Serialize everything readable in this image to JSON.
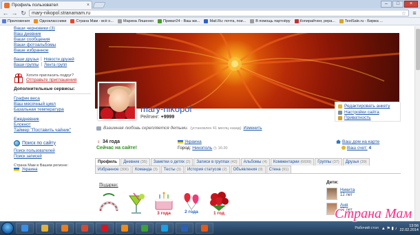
{
  "browser": {
    "tab_title": "Профиль пользовател",
    "url": "mary-nikopol.stranamam.ru",
    "bookmarks": [
      {
        "label": "Приложения",
        "color": "#5b7bd5",
        "icon": "apps-icon"
      },
      {
        "label": "Одноклассники",
        "color": "#f28a1a",
        "icon": "odnoklassniki-icon"
      },
      {
        "label": "Страна Мам - всё о...",
        "color": "#e7452e",
        "icon": "stranamam-icon"
      },
      {
        "label": "Марина Ляшенко",
        "color": "#9c9c9c",
        "icon": "page-icon"
      },
      {
        "label": "Приват24 - Ваш жи...",
        "color": "#4a9a2a",
        "icon": "privat24-icon"
      },
      {
        "label": "Mail.Ru: почта, пои...",
        "color": "#2c62c9",
        "icon": "mailru-icon"
      },
      {
        "label": "В помощь партнёру",
        "color": "#9c9c9c",
        "icon": "page-icon"
      },
      {
        "label": "Копирайтинг, рера...",
        "color": "#c43232",
        "icon": "copywriting-icon"
      },
      {
        "label": "TextSale.ru - Биржа ...",
        "color": "#d6a42b",
        "icon": "textsale-icon"
      }
    ]
  },
  "sidebar": {
    "top_links": [
      "Ваши черновики (3)",
      "Ваш дневник",
      "Ваши сообщения",
      "Ваши фотоальбомы",
      "Ваше избранное"
    ],
    "friends_link": "Ваши друзья",
    "friends_news": "Новости друзей",
    "groups_link": "Ваши группы",
    "groups_feed": "Лента групп",
    "invite_question": "Хотите пригласить подруг?",
    "invite_action": "Отправьте приглашения",
    "services_title": "Дополнительные сервисы:",
    "services": [
      "График веса",
      "Ваш месячный цикл",
      "Базальная температура"
    ],
    "services2": [
      "Ежедневник",
      "Блокнот",
      "Таймер \"Поставить чайник\""
    ],
    "search_link": "Поиск по сайту",
    "search_users": "Поиск пользователей",
    "search_posts": "Поиск записей",
    "region_text": "Страна Мам в Вашем регионе:",
    "region": "Украина"
  },
  "profile": {
    "username": "mary-nikopol",
    "rating_label": "Рейтинг:",
    "rating_value": "+9999",
    "status": "Взаимная любовь скрепляется детьми.",
    "status_date": "(установлен 41 месяц назад)",
    "status_change": "Изменить",
    "age": "34 года",
    "online": "Сейчас на сайте!",
    "country": "Украина",
    "city_label": "Город:",
    "city": "Никополь",
    "time": "16:20",
    "house_link": "Ваш дом на карте",
    "account_label": "Ваш счет:",
    "account_value": "4"
  },
  "anketa": {
    "edit": "Редактировать анкету",
    "settings": "Настройки сайта",
    "privacy": "Приватность"
  },
  "tabs_row1": [
    {
      "label": "Профиль",
      "count": "",
      "active": true
    },
    {
      "label": "Дневник",
      "count": "(35)",
      "active": false
    },
    {
      "label": "Заметки о детях",
      "count": "(2)",
      "active": false
    },
    {
      "label": "Записи в группах",
      "count": "(42)",
      "active": false
    },
    {
      "label": "Альбомы",
      "count": "(4)",
      "active": false
    },
    {
      "label": "Комментарии",
      "count": "(6699)",
      "active": false
    },
    {
      "label": "Группы",
      "count": "(37)",
      "active": false
    },
    {
      "label": "Друзья",
      "count": "(39)",
      "active": false
    }
  ],
  "tabs_row2": [
    {
      "label": "Избранное",
      "count": "(306)"
    },
    {
      "label": "Команда",
      "count": "(3)"
    },
    {
      "label": "Тесты",
      "count": "(3)"
    },
    {
      "label": "История статусов",
      "count": "(2)"
    },
    {
      "label": "Объявления",
      "count": "(9)"
    },
    {
      "label": "Стена",
      "count": "(91)"
    }
  ],
  "gifts": {
    "title": "Подарки:",
    "items": [
      {
        "icon": "horseshoe-gift-icon",
        "caption": ""
      },
      {
        "icon": "cocktail-gift-icon",
        "caption": ""
      },
      {
        "icon": "cake-3years-gift-icon",
        "caption": "3 года"
      },
      {
        "icon": "balloons-2years-gift-icon",
        "caption": "2 года"
      },
      {
        "icon": "roses-1year-gift-icon",
        "caption": "1 год"
      }
    ]
  },
  "children": {
    "title": "Дети:",
    "list": [
      {
        "name": "Никита",
        "age": "12 лет"
      },
      {
        "name": "Аня",
        "age": "12 лет"
      }
    ]
  },
  "taskbar": {
    "desktop_label": "Рабочий стол",
    "time": "13:56",
    "date": "22.02.2014",
    "apps": [
      {
        "icon": "explorer-icon",
        "color": "#3a8ee6"
      },
      {
        "icon": "folder-icon",
        "color": "#e3b23c"
      },
      {
        "icon": "media-player-icon",
        "color": "#ea7d1f"
      },
      {
        "icon": "bookmark-icon",
        "color": "#d24a36"
      },
      {
        "icon": "opera-icon",
        "color": "#d8151f"
      },
      {
        "icon": "vlc-icon",
        "color": "#f08a18"
      },
      {
        "icon": "chrome-icon",
        "color": "#3e9f3b"
      },
      {
        "icon": "skype-icon",
        "color": "#1ca1e2"
      },
      {
        "icon": "word-icon",
        "color": "#2b5fb3"
      },
      {
        "icon": "agent-icon",
        "color": "#e15a1c"
      }
    ]
  },
  "watermark": "Страна Мам"
}
